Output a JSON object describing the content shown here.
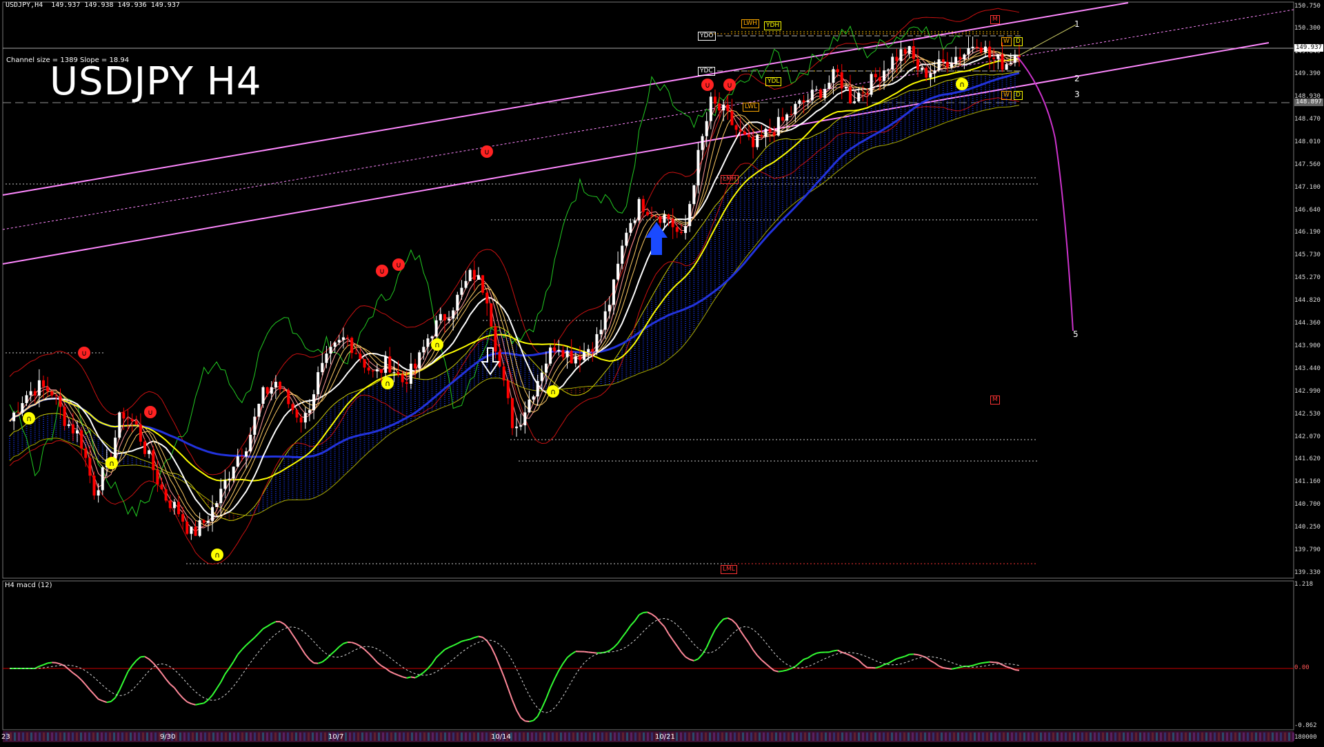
{
  "header": {
    "symbol_line": "USDJPY,H4  149.937 149.938 149.936 149.937",
    "channel_info": "Channel size = 1389 Slope = 18.94",
    "title": "USDJPY H4"
  },
  "macd_panel": {
    "label": "H4  macd (12)",
    "scale": [
      "1.218",
      "0.00",
      "-0.862"
    ],
    "bottom_value": "180000"
  },
  "price_scale": [
    "150.750",
    "150.300",
    "149.840",
    "149.390",
    "148.930",
    "148.470",
    "148.010",
    "147.560",
    "147.100",
    "146.640",
    "146.190",
    "145.730",
    "145.270",
    "144.820",
    "144.360",
    "143.900",
    "143.440",
    "142.990",
    "142.530",
    "142.070",
    "141.620",
    "141.160",
    "140.700",
    "140.250",
    "139.790",
    "139.330"
  ],
  "price_badges": {
    "bid": "149.937",
    "line": "148.897"
  },
  "level_labels": {
    "ydo": "YDO",
    "lwh": "LWH",
    "ydh": "YDH",
    "ydc": "YDC",
    "ydl": "YDL",
    "lwl": "LWL",
    "lmh": "LMH",
    "lml": "LML",
    "w1": "W",
    "d1": "D",
    "w2": "W",
    "d2": "D",
    "m1": "M",
    "m2": "M"
  },
  "wave_labels": [
    "1",
    "2",
    "3",
    "5"
  ],
  "date_labels": [
    "23",
    "9/30",
    "10/7",
    "10/14",
    "10/21"
  ],
  "colors": {
    "background": "#000000",
    "bull_candle": "#ffffff",
    "bear_candle": "#ff0000",
    "channel": "#ff88ff",
    "kumo": "#1a3aff",
    "sma_long": "#2233dd",
    "sma_mid": "#ffff00",
    "ema_fast": "#ffffff",
    "bands": "#cc1111",
    "chikou": "#22cc22",
    "macd_up": "#33ff33",
    "macd_down": "#ff8899"
  },
  "chart_data": {
    "type": "candlestick",
    "title": "USDJPY H4",
    "instrument": "USDJPY",
    "timeframe": "H4",
    "ylim": [
      139.33,
      150.75
    ],
    "last": 149.937,
    "x_ticks": [
      "9/30",
      "10/7",
      "10/14",
      "10/21"
    ],
    "close_path": [
      142.4,
      142.9,
      143.1,
      143.0,
      142.4,
      142.1,
      141.0,
      141.5,
      142.6,
      142.3,
      141.6,
      140.9,
      140.6,
      140.1,
      140.4,
      140.9,
      141.6,
      142.0,
      142.9,
      143.2,
      142.7,
      142.4,
      143.3,
      143.8,
      144.1,
      143.7,
      143.3,
      143.6,
      143.2,
      143.5,
      144.2,
      144.5,
      144.9,
      145.4,
      145.0,
      143.4,
      142.2,
      142.8,
      143.5,
      144.0,
      143.7,
      143.8,
      144.1,
      145.0,
      146.3,
      146.8,
      146.6,
      146.5,
      146.0,
      147.6,
      148.8,
      148.6,
      148.2,
      147.9,
      148.2,
      148.4,
      148.7,
      148.9,
      149.1,
      149.4,
      148.9,
      149.1,
      149.4,
      149.7,
      149.9,
      149.4,
      149.5,
      149.7,
      149.8,
      150.1,
      149.7,
      149.6,
      149.9
    ]
  }
}
